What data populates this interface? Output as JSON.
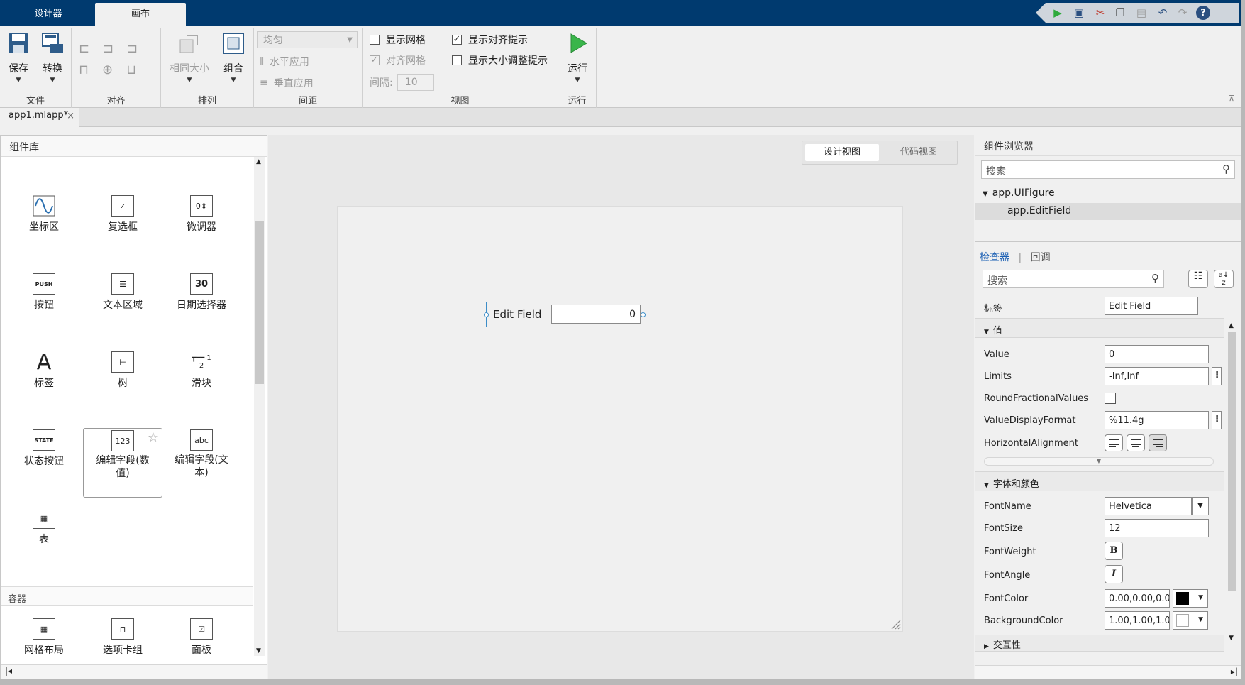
{
  "top_tabs": [
    "设计器",
    "画布"
  ],
  "ribbon": {
    "file": {
      "title": "文件",
      "save": "保存",
      "convert": "转换"
    },
    "align": {
      "title": "对齐"
    },
    "arrange": {
      "title": "排列",
      "same_size": "相同大小",
      "group": "组合"
    },
    "spacing": {
      "title": "间距",
      "even": "均匀",
      "apply_h": "水平应用",
      "apply_v": "垂直应用"
    },
    "view": {
      "title": "视图",
      "show_grid": "显示网格",
      "snap_grid": "对齐网格",
      "interval_label": "间隔:",
      "interval_value": "10",
      "show_align_hints": "显示对齐提示",
      "show_resize_hints": "显示大小调整提示"
    },
    "run": {
      "title": "运行",
      "run": "运行"
    }
  },
  "doc_tab": "app1.mlapp*",
  "library": {
    "title": "组件库",
    "items": [
      "坐标区",
      "复选框",
      "微调器",
      "按钮",
      "文本区域",
      "日期选择器",
      "标签",
      "树",
      "滑块",
      "状态按钮",
      "编辑字段(数值)",
      "编辑字段(文本)",
      "表"
    ],
    "hovered_line1": "编辑字段(数",
    "hovered_line2": "值)",
    "text_line1": "编辑字段(文",
    "text_line2": "本)",
    "container_title": "容器",
    "containers": [
      "网格布局",
      "选项卡组",
      "面板"
    ]
  },
  "canvas": {
    "tab_design": "设计视图",
    "tab_code": "代码视图",
    "field_label": "Edit Field",
    "field_value": "0"
  },
  "browser": {
    "title": "组件浏览器",
    "search_placeholder": "搜索",
    "root": "app.UIFigure",
    "child": "app.EditField"
  },
  "inspector": {
    "tab_inspector": "检查器",
    "tab_callback": "回调",
    "search_placeholder": "搜索",
    "label_name": "标签",
    "label_value": "Edit Field",
    "section_value": "值",
    "value": {
      "name": "Value",
      "val": "0"
    },
    "limits": {
      "name": "Limits",
      "val": "-Inf,Inf"
    },
    "round": {
      "name": "RoundFractionalValues"
    },
    "format": {
      "name": "ValueDisplayFormat",
      "val": "%11.4g"
    },
    "halign": {
      "name": "HorizontalAlignment"
    },
    "section_font": "字体和颜色",
    "fontname": {
      "name": "FontName",
      "val": "Helvetica"
    },
    "fontsize": {
      "name": "FontSize",
      "val": "12"
    },
    "fontweight": {
      "name": "FontWeight",
      "val": "B"
    },
    "fontangle": {
      "name": "FontAngle",
      "val": "I"
    },
    "fontcolor": {
      "name": "FontColor",
      "val": "0.00,0.00,0.0"
    },
    "bgcolor": {
      "name": "BackgroundColor",
      "val": "1.00,1.00,1.0"
    },
    "section_interact": "交互性"
  },
  "colors": {
    "title_bar": "#003a6f",
    "run_green": "#39b54a",
    "link_blue": "#1a5fb4"
  }
}
